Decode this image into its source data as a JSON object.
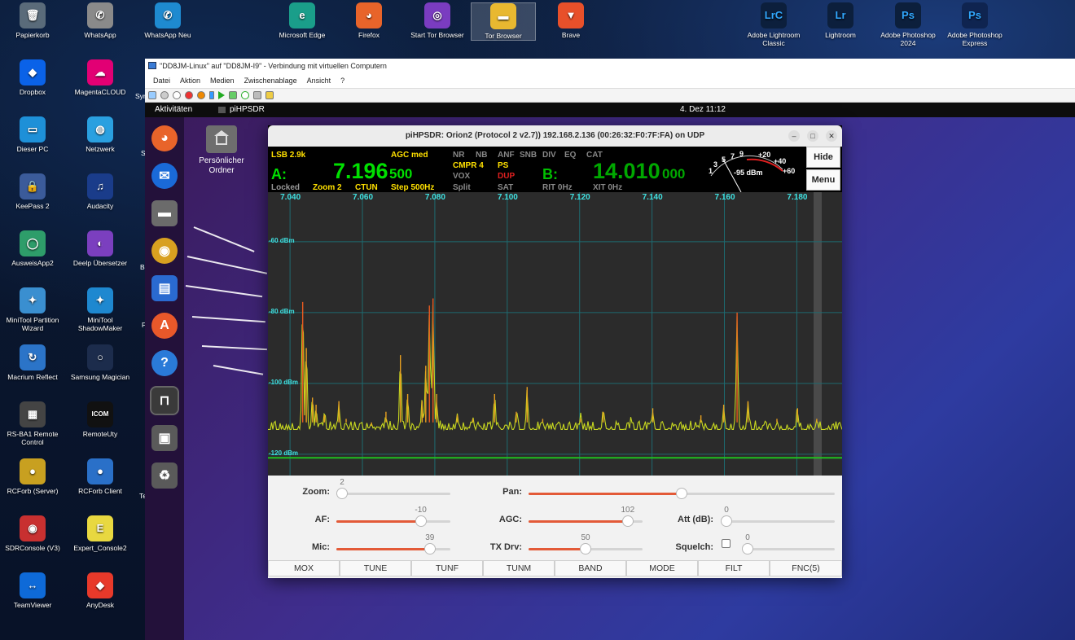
{
  "desktop": {
    "icons_left": [
      {
        "label": "Papierkorb",
        "icon": "trash-icon",
        "color": "#5a6b7a",
        "glyph": "🗑"
      },
      {
        "label": "Dropbox",
        "icon": "dropbox-icon",
        "color": "#0a62e8",
        "glyph": "◆"
      },
      {
        "label": "Dieser PC",
        "icon": "computer-icon",
        "color": "#1e90d8",
        "glyph": "▭"
      },
      {
        "label": "KeePass 2",
        "icon": "keepass-icon",
        "color": "#3b5b9a",
        "glyph": "🔒"
      },
      {
        "label": "AusweisApp2",
        "icon": "ausweisapp-icon",
        "color": "#2e9d6a",
        "glyph": "◯"
      },
      {
        "label": "MiniTool Partition Wizard",
        "icon": "minitool-partition-icon",
        "color": "#3a8fd0",
        "glyph": "✦"
      },
      {
        "label": "Macrium Reflect",
        "icon": "macrium-icon",
        "color": "#2b74c8",
        "glyph": "↻"
      },
      {
        "label": "RS-BA1 Remote Control",
        "icon": "rsba1-icon",
        "color": "#444",
        "glyph": "▦"
      },
      {
        "label": "RCForb (Server)",
        "icon": "rcforb-server-icon",
        "color": "#c8a020",
        "glyph": "●"
      },
      {
        "label": "SDRConsole (V3)",
        "icon": "sdrconsole-icon",
        "color": "#c83030",
        "glyph": "◉"
      },
      {
        "label": "TeamViewer",
        "icon": "teamviewer-icon",
        "color": "#0e6ad8",
        "glyph": "↔"
      }
    ],
    "icons_mid": [
      {
        "label": "WhatsApp",
        "icon": "whatsapp-icon",
        "color": "#8a8a8a",
        "glyph": "✆"
      },
      {
        "label": "MagentaCLOUD",
        "icon": "magentacloud-icon",
        "color": "#e20074",
        "glyph": "☁"
      },
      {
        "label": "Netzwerk",
        "icon": "network-icon",
        "color": "#2aa0e0",
        "glyph": "◍"
      },
      {
        "label": "Audacity",
        "icon": "audacity-icon",
        "color": "#1a3c8a",
        "glyph": "♫"
      },
      {
        "label": "Deelp Übersetzer",
        "icon": "deepl-icon",
        "color": "#7b3fbf",
        "glyph": "◐"
      },
      {
        "label": "MiniTool ShadowMaker",
        "icon": "minitool-shadowmaker-icon",
        "color": "#1e88d0",
        "glyph": "✦"
      },
      {
        "label": "Samsung Magician",
        "icon": "samsung-magician-icon",
        "color": "#1c2c4c",
        "glyph": "○"
      },
      {
        "label": "RemoteUty",
        "icon": "remoteuty-icon",
        "color": "#111",
        "glyph": "ICOM"
      },
      {
        "label": "RCForb Client",
        "icon": "rcforb-client-icon",
        "color": "#2a70c8",
        "glyph": "●"
      },
      {
        "label": "Expert_Console2",
        "icon": "expert-console-icon",
        "color": "#e8d840",
        "glyph": "E"
      },
      {
        "label": "AnyDesk",
        "icon": "anydesk-icon",
        "color": "#e8392a",
        "glyph": "◆"
      }
    ],
    "icons_top": [
      {
        "label": "WhatsApp Neu",
        "icon": "whatsapp-new-icon",
        "color": "#1e8ad0",
        "glyph": "✆"
      },
      {
        "label": "Microsoft Edge",
        "icon": "edge-icon",
        "color": "#1a9e8a",
        "glyph": "e"
      },
      {
        "label": "Firefox",
        "icon": "firefox-icon",
        "color": "#e8642a",
        "glyph": "◕"
      },
      {
        "label": "Start Tor Browser",
        "icon": "tor-browser-start-icon",
        "color": "#7a3cc0",
        "glyph": "◎"
      },
      {
        "label": "Tor Browser",
        "icon": "tor-browser-folder-icon",
        "color": "#e8b830",
        "glyph": "▬"
      },
      {
        "label": "Brave",
        "icon": "brave-icon",
        "color": "#e8502a",
        "glyph": "▼"
      }
    ],
    "icons_right": [
      {
        "label": "Adobe Lightroom Classic",
        "icon": "lightroom-classic-icon",
        "color": "#0c1f3c",
        "glyph": "LrC",
        "fg": "#31a8ff"
      },
      {
        "label": "Lightroom",
        "icon": "lightroom-icon",
        "color": "#0c1f3c",
        "glyph": "Lr",
        "fg": "#31a8ff"
      },
      {
        "label": "Adobe Photoshop 2024",
        "icon": "photoshop-icon",
        "color": "#0c1f3c",
        "glyph": "Ps",
        "fg": "#31a8ff"
      },
      {
        "label": "Adobe Photoshop Express",
        "icon": "photoshop-express-icon",
        "color": "#0f2450",
        "glyph": "Ps",
        "fg": "#31a8ff"
      }
    ],
    "partial_labels": [
      "Syn",
      "S",
      "Br",
      "F",
      "Te"
    ]
  },
  "hyperv": {
    "title": "\"DD8JM-Linux\" auf \"DD8JM-I9\" - Verbindung mit virtuellen Computern",
    "menu": [
      "Datei",
      "Aktion",
      "Medien",
      "Zwischenablage",
      "Ansicht",
      "?"
    ]
  },
  "ubuntu": {
    "activities": "Aktivitäten",
    "app": "piHPSDR",
    "clock": "4. Dez  11:12",
    "home_folder": "Persönlicher Ordner",
    "dock": [
      "firefox-icon",
      "thunderbird-icon",
      "files-icon",
      "rhythmbox-icon",
      "writer-icon",
      "software-icon",
      "help-icon",
      "pihpsdr-icon",
      "save-icon",
      "trash-icon"
    ]
  },
  "sdr": {
    "title": "piHPSDR: Orion2 (Protocol 2 v2.7)) 192.168.2.136 (00:26:32:F0:7F:FA) on UDP",
    "mode": "LSB 2.9k",
    "agc": "AGC med",
    "vfo_a_label": "A:",
    "vfo_a_main": "7.196",
    "vfo_a_sub": "500",
    "vfo_b_label": "B:",
    "vfo_b_main": "14.010",
    "vfo_b_sub": "000",
    "locked": "Locked",
    "zoom": "Zoom 2",
    "ctun": "CTUN",
    "step": "Step 500Hz",
    "nr": "NR",
    "nb": "NB",
    "anf": "ANF",
    "snb": "SNB",
    "div": "DIV",
    "eq": "EQ",
    "cat": "CAT",
    "cmpr": "CMPR 4",
    "ps": "PS",
    "vox": "VOX",
    "dup": "DUP",
    "split": "Split",
    "sat": "SAT",
    "rit": "RIT 0Hz",
    "xit": "XIT 0Hz",
    "meter": {
      "value": "-95 dBm",
      "scale": [
        "1",
        "3",
        "5",
        "7",
        "9",
        "+20",
        "+40",
        "+60"
      ],
      "reading_dbm": -95
    },
    "hide": "Hide",
    "menu": "Menu",
    "freq_ticks": [
      "7.040",
      "7.060",
      "7.080",
      "7.100",
      "7.120",
      "7.140",
      "7.160",
      "7.180"
    ],
    "dbm_ticks": [
      "-60 dBm",
      "-80 dBm",
      "-100 dBm",
      "-120 dBm"
    ],
    "sliders": {
      "zoom": {
        "label": "Zoom:",
        "value": "2",
        "frac": 0.0
      },
      "pan": {
        "label": "Pan:",
        "value": "",
        "frac": 0.5
      },
      "af": {
        "label": "AF:",
        "value": "-10",
        "frac": 0.74
      },
      "agc": {
        "label": "AGC:",
        "value": "102",
        "frac": 0.87
      },
      "att": {
        "label": "Att (dB):",
        "value": "0",
        "frac": 0.0
      },
      "mic": {
        "label": "Mic:",
        "value": "39",
        "frac": 0.82
      },
      "txdrv": {
        "label": "TX Drv:",
        "value": "50",
        "frac": 0.5
      },
      "squelch": {
        "label": "Squelch:",
        "value": "0",
        "frac": 0.0
      }
    },
    "buttons": [
      "MOX",
      "TUNE",
      "TUNF",
      "TUNM",
      "BAND",
      "MODE",
      "FILT",
      "FNC(5)"
    ],
    "spectrum_peaks": [
      {
        "f": 7.0435,
        "db": -77
      },
      {
        "f": 7.0445,
        "db": -90
      },
      {
        "f": 7.0462,
        "db": -104
      },
      {
        "f": 7.0472,
        "db": -106
      },
      {
        "f": 7.0495,
        "db": -109
      },
      {
        "f": 7.0535,
        "db": -105
      },
      {
        "f": 7.0555,
        "db": -110
      },
      {
        "f": 7.0625,
        "db": -112
      },
      {
        "f": 7.0665,
        "db": -108
      },
      {
        "f": 7.0705,
        "db": -92
      },
      {
        "f": 7.0725,
        "db": -103
      },
      {
        "f": 7.0785,
        "db": -78
      },
      {
        "f": 7.0795,
        "db": -76
      },
      {
        "f": 7.0775,
        "db": -95
      },
      {
        "f": 7.0765,
        "db": -105
      },
      {
        "f": 7.0805,
        "db": -103
      },
      {
        "f": 7.0862,
        "db": -109
      },
      {
        "f": 7.0905,
        "db": -110
      },
      {
        "f": 7.0965,
        "db": -103
      },
      {
        "f": 7.1025,
        "db": -108
      },
      {
        "f": 7.1055,
        "db": -101
      },
      {
        "f": 7.1098,
        "db": -110
      },
      {
        "f": 7.1202,
        "db": -110
      },
      {
        "f": 7.1265,
        "db": -108
      },
      {
        "f": 7.1342,
        "db": -111
      },
      {
        "f": 7.1402,
        "db": -107
      },
      {
        "f": 7.1535,
        "db": -109
      },
      {
        "f": 7.1598,
        "db": -106
      },
      {
        "f": 7.1635,
        "db": -80
      },
      {
        "f": 7.1665,
        "db": -105
      },
      {
        "f": 7.1745,
        "db": -110
      },
      {
        "f": 7.1802,
        "db": -107
      },
      {
        "f": 7.1855,
        "db": -110
      }
    ]
  }
}
